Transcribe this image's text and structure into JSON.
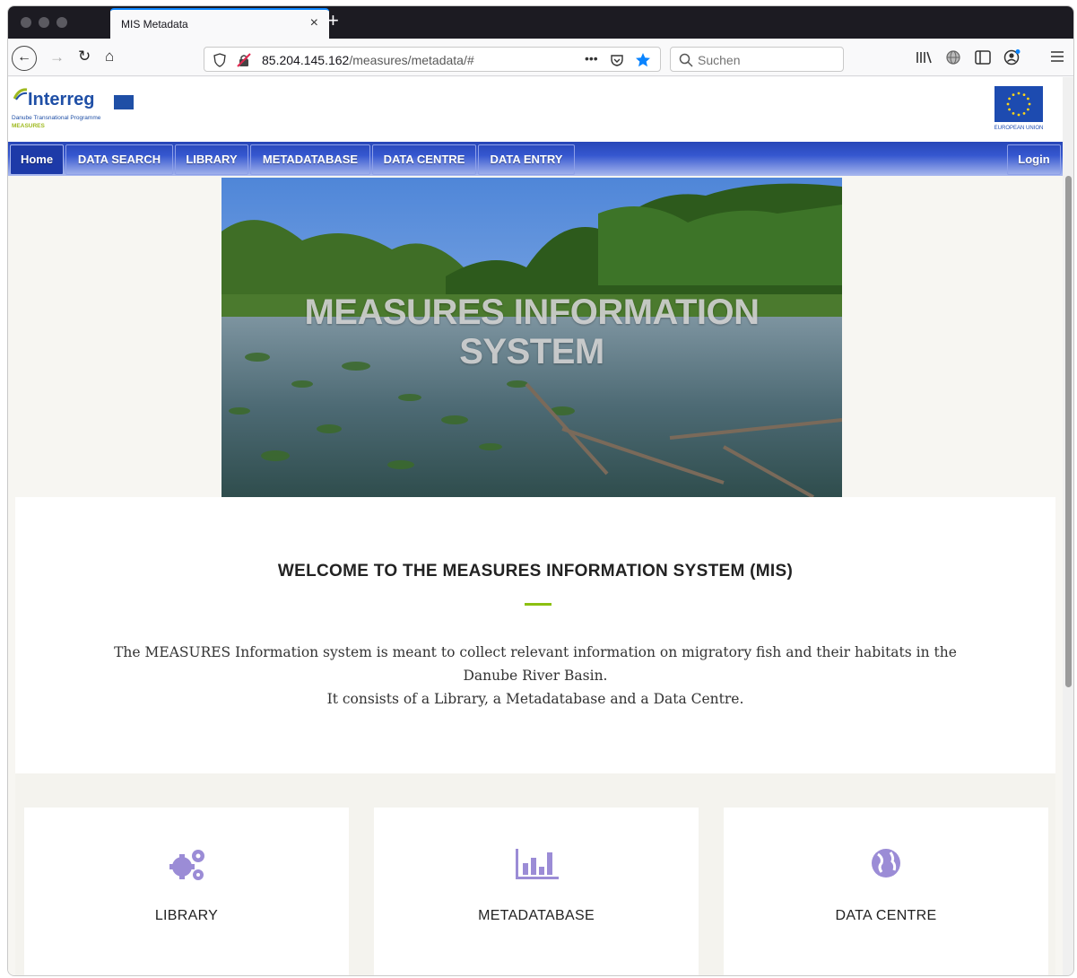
{
  "browser": {
    "tab_title": "MIS Metadata",
    "url_host": "85.204.145.162",
    "url_path": "/measures/metadata/#",
    "search_placeholder": "Suchen",
    "page_actions_label": "•••"
  },
  "header": {
    "logo_word": "Interreg",
    "logo_subtitle": "Danube Transnational Programme",
    "logo_project": "MEASURES",
    "eu_label": "EUROPEAN UNION"
  },
  "menu": {
    "items": [
      {
        "label": "Home"
      },
      {
        "label": "DATA SEARCH"
      },
      {
        "label": "LIBRARY"
      },
      {
        "label": "METADATABASE"
      },
      {
        "label": "DATA CENTRE"
      },
      {
        "label": "DATA ENTRY"
      }
    ],
    "login": "Login"
  },
  "hero": {
    "title_line1": "MEASURES INFORMATION",
    "title_line2": "SYSTEM"
  },
  "welcome": {
    "title": "WELCOME TO THE MEASURES INFORMATION SYSTEM (MIS)",
    "line1": "The MEASURES Information system is meant to collect relevant information on migratory fish and their habitats in the",
    "line2": "Danube River Basin.",
    "line3": "It consists of a Library, a Metadatabase and a Data Centre."
  },
  "cards": [
    {
      "label": "LIBRARY",
      "icon": "gears-icon"
    },
    {
      "label": "METADATABASE",
      "icon": "bar-chart-icon"
    },
    {
      "label": "DATA CENTRE",
      "icon": "globe-icon"
    }
  ],
  "colors": {
    "menu_blue": "#2746b8",
    "accent_green": "#8cc011",
    "icon_purple": "#9b8cd6"
  }
}
